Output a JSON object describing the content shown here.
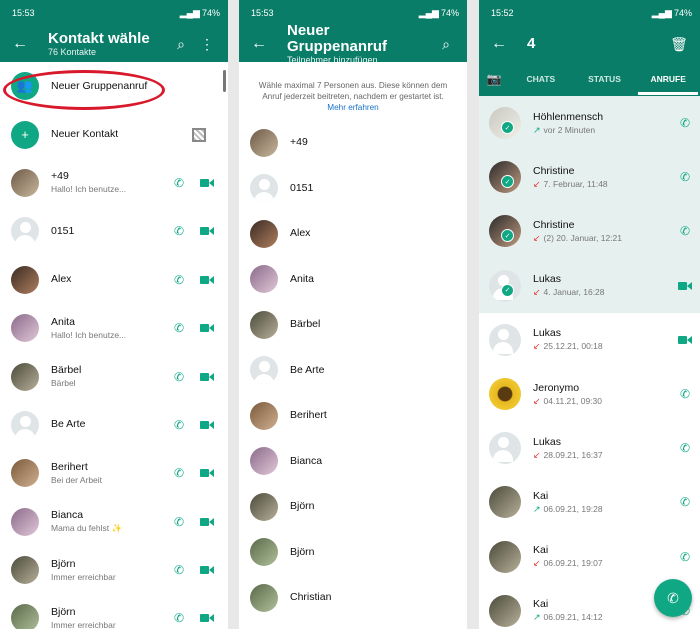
{
  "panel1": {
    "status": {
      "time": "15:53",
      "battery": "74%"
    },
    "header": {
      "title": "Kontakt wähle",
      "subtitle": "76 Kontakte"
    },
    "top_items": [
      {
        "name": "Neuer Gruppenanruf",
        "icon": "group-icon"
      },
      {
        "name": "Neuer Kontakt",
        "icon": "add-person-icon"
      }
    ],
    "contacts": [
      {
        "name": "+49",
        "sub": "Hallo! Ich benutze..."
      },
      {
        "name": "0151",
        "sub": ""
      },
      {
        "name": "Alex",
        "sub": ""
      },
      {
        "name": "Anita",
        "sub": "Hallo! Ich benutze..."
      },
      {
        "name": "Bärbel",
        "sub": "Bärbel"
      },
      {
        "name": "Be Arte",
        "sub": ""
      },
      {
        "name": "Berihert",
        "sub": "Bei der Arbeit"
      },
      {
        "name": "Bianca",
        "sub": "Mama du fehlst ✨"
      },
      {
        "name": "Björn",
        "sub": "Immer erreichbar"
      },
      {
        "name": "Björn",
        "sub": "Immer erreichbar"
      }
    ]
  },
  "panel2": {
    "status": {
      "time": "15:53",
      "battery": "74%"
    },
    "header": {
      "title": "Neuer Gruppenanruf",
      "subtitle": "Teilnehmer hinzufügen"
    },
    "notice": "Wähle maximal 7 Personen aus. Diese können dem Anruf jederzeit beitreten, nachdem er gestartet ist.",
    "notice_link": "Mehr erfahren",
    "contacts": [
      "+49",
      "0151",
      "Alex",
      "Anita",
      "Bärbel",
      "Be Arte",
      "Berihert",
      "Bianca",
      "Björn",
      "Björn",
      "Christian"
    ]
  },
  "panel3": {
    "status": {
      "time": "15:52",
      "battery": "74%"
    },
    "header": {
      "title": "4"
    },
    "tabs": [
      "CHATS",
      "STATUS",
      "ANRUFE"
    ],
    "calls": [
      {
        "name": "Höhlenmensch",
        "detail": "vor 2 Minuten",
        "dir": "↗",
        "type": "out",
        "media": "phone",
        "selected": true
      },
      {
        "name": "Christine",
        "detail": "7. Februar, 11:48",
        "dir": "↙",
        "type": "miss",
        "media": "phone",
        "selected": true
      },
      {
        "name": "Christine",
        "detail": "(2)  20. Januar, 12:21",
        "dir": "↙",
        "type": "miss",
        "media": "phone",
        "selected": true
      },
      {
        "name": "Lukas",
        "detail": "4. Januar, 16:28",
        "dir": "↙",
        "type": "miss",
        "media": "video",
        "selected": true
      },
      {
        "name": "Lukas",
        "detail": "25.12.21, 00:18",
        "dir": "↙",
        "type": "miss",
        "media": "video",
        "selected": false
      },
      {
        "name": "Jeronymo",
        "detail": "04.11.21, 09:30",
        "dir": "↙",
        "type": "miss",
        "media": "phone",
        "selected": false
      },
      {
        "name": "Lukas",
        "detail": "28.09.21, 16:37",
        "dir": "↙",
        "type": "miss",
        "media": "phone",
        "selected": false
      },
      {
        "name": "Kai",
        "detail": "06.09.21, 19:28",
        "dir": "↗",
        "type": "out",
        "media": "phone",
        "selected": false
      },
      {
        "name": "Kai",
        "detail": "06.09.21, 19:07",
        "dir": "↙",
        "type": "miss",
        "media": "phone",
        "selected": false
      },
      {
        "name": "Kai",
        "detail": "06.09.21, 14:12",
        "dir": "↗",
        "type": "out",
        "media": "phone",
        "selected": false
      }
    ]
  },
  "colors": {
    "brand": "#0a7d68",
    "accent": "#10a884",
    "missed": "#e53935",
    "highlight": "#d8182b"
  }
}
